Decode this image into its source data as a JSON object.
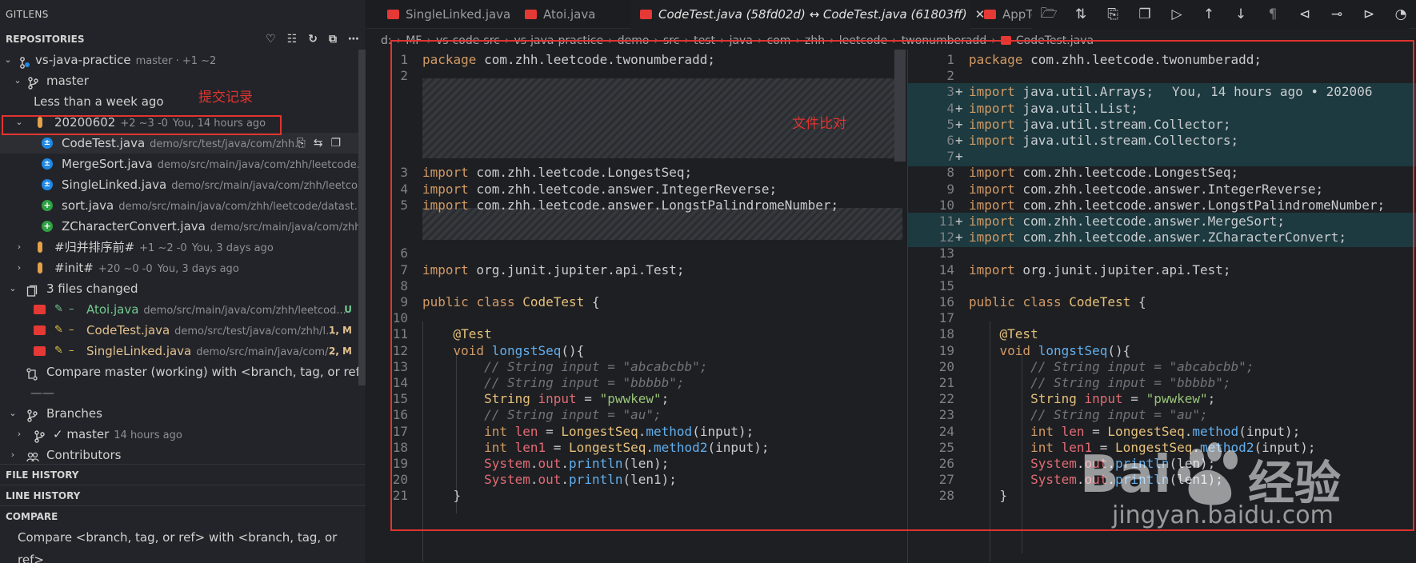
{
  "app": {
    "panel_title": "GITLENS"
  },
  "repositories": {
    "title": "REPOSITORIES",
    "repo": {
      "name": "vs-java-practice",
      "meta": "master · +1 ~2"
    },
    "branch": {
      "name": "master"
    },
    "period": "Less than a week ago",
    "commits": [
      {
        "hash": "20200602",
        "stats": "+2 ~3 -0",
        "when": "You, 14 hours ago",
        "files": [
          {
            "name": "CodeTest.java",
            "path": "demo/src/test/java/com/zhh..."
          },
          {
            "name": "MergeSort.java",
            "path": "demo/src/main/java/com/zhh/leetcode..."
          },
          {
            "name": "SingleLinked.java",
            "path": "demo/src/main/java/com/zhh/leetco..."
          },
          {
            "name": "sort.java",
            "path": "demo/src/main/java/com/zhh/leetcode/datast..."
          },
          {
            "name": "ZCharacterConvert.java",
            "path": "demo/src/main/java/com/zhh/..."
          }
        ]
      },
      {
        "hash": "#归并排序前#",
        "stats": "+1 ~2 -0",
        "when": "You, 3 days ago"
      },
      {
        "hash": "#init#",
        "stats": "+20 ~0 -0",
        "when": "You, 3 days ago"
      }
    ],
    "changed": {
      "label": "3 files changed",
      "files": [
        {
          "name": "Atoi.java",
          "path": "demo/src/main/java/com/zhh/leetcod...",
          "badge": "U",
          "color": "#73c991"
        },
        {
          "name": "CodeTest.java",
          "path": "demo/src/test/java/com/zhh/l...",
          "badge": "1, M",
          "color": "#e2c08d"
        },
        {
          "name": "SingleLinked.java",
          "path": "demo/src/main/java/com/...",
          "badge": "2, M",
          "color": "#e2c08d"
        }
      ],
      "pencil": "✎",
      "dash": "–"
    },
    "compare_working": "Compare master (working) with <branch, tag, or ref>",
    "divider": "——",
    "branches": {
      "label": "Branches",
      "item": "master",
      "item_when": "14 hours ago",
      "check": "✓"
    },
    "contributors": "Contributors"
  },
  "sections": {
    "file_history": "FILE HISTORY",
    "line_history": "LINE HISTORY",
    "compare": "COMPARE",
    "compare_item": "Compare <branch, tag, or ref> with <branch, tag, or ref>"
  },
  "tabs": [
    {
      "label": "SingleLinked.java"
    },
    {
      "label": "Atoi.java"
    },
    {
      "label": "CodeTest.java (58fd02d) ↔ CodeTest.java (61803ff)",
      "active": true
    },
    {
      "label": "AppTe"
    }
  ],
  "breadcrumb": [
    "d:",
    "MF",
    "vs-code-src",
    "vs-java-practice",
    "demo",
    "src",
    "test",
    "java",
    "com",
    "zhh",
    "leetcode",
    "twonumberadd",
    "CodeTest.java"
  ],
  "annotations": {
    "commit_records": "提交记录",
    "file_compare": "文件比对"
  },
  "left_editor": {
    "lines": [
      {
        "n": "1",
        "html": "<span class='kw'>package</span> com.zhh.leetcode.twonumberadd;"
      },
      {
        "n": "2",
        "html": ""
      },
      {
        "n": "3",
        "html": "<span class='kw'>import</span> com.zhh.leetcode.LongestSeq;"
      },
      {
        "n": "4",
        "html": "<span class='kw'>import</span> com.zhh.leetcode.answer.IntegerReverse;"
      },
      {
        "n": "5",
        "html": "<span class='kw'>import</span> com.zhh.leetcode.answer.LongstPalindromeNumber;"
      },
      {
        "n": "6",
        "html": ""
      },
      {
        "n": "7",
        "html": "<span class='kw'>import</span> org.junit.jupiter.api.Test;"
      },
      {
        "n": "8",
        "html": ""
      },
      {
        "n": "9",
        "html": "<span class='kw'>public</span> <span class='kw'>class</span> <span class='ty'>CodeTest</span> {"
      },
      {
        "n": "10",
        "html": ""
      },
      {
        "n": "11",
        "html": "    <span class='ann'>@Test</span>"
      },
      {
        "n": "12",
        "html": "    <span class='kw'>void</span> <span class='fn'>longstSeq</span>(){"
      },
      {
        "n": "13",
        "html": "        <span class='cm'>// String input = \"abcabcbb\";</span>"
      },
      {
        "n": "14",
        "html": "        <span class='cm'>// String input = \"bbbbb\";</span>"
      },
      {
        "n": "15",
        "html": "        <span class='ty'>String</span> <span class='var'>input</span> = <span class='str'>\"pwwkew\"</span>;"
      },
      {
        "n": "16",
        "html": "        <span class='cm'>// String input = \"au\";</span>"
      },
      {
        "n": "17",
        "html": "        <span class='kw'>int</span> <span class='var'>len</span> = <span class='ty'>LongestSeq</span>.<span class='fn'>method</span>(input);"
      },
      {
        "n": "18",
        "html": "        <span class='kw'>int</span> <span class='var'>len1</span> = <span class='ty'>LongestSeq</span>.<span class='fn'>method2</span>(input);"
      },
      {
        "n": "19",
        "html": "        <span class='var'>System</span>.<span class='var'>out</span>.<span class='fn'>println</span>(len);"
      },
      {
        "n": "20",
        "html": "        <span class='var'>System</span>.<span class='var'>out</span>.<span class='fn'>println</span>(len1);"
      },
      {
        "n": "21",
        "html": "    }"
      }
    ]
  },
  "right_editor": {
    "blame": "You, 14 hours ago • 202006",
    "lines": [
      {
        "n": "1",
        "html": "<span class='kw'>package</span> com.zhh.leetcode.twonumberadd;"
      },
      {
        "n": "2",
        "html": ""
      },
      {
        "n": "3",
        "add": true,
        "html": "<span class='kw'>import</span> java.util.Arrays;"
      },
      {
        "n": "4",
        "add": true,
        "html": "<span class='kw'>import</span> java.util.List;"
      },
      {
        "n": "5",
        "add": true,
        "html": "<span class='kw'>import</span> java.util.stream.Collector;"
      },
      {
        "n": "6",
        "add": true,
        "html": "<span class='kw'>import</span> java.util.stream.Collectors;"
      },
      {
        "n": "7",
        "add": true,
        "html": ""
      },
      {
        "n": "8",
        "html": "<span class='kw'>import</span> com.zhh.leetcode.LongestSeq;"
      },
      {
        "n": "9",
        "html": "<span class='kw'>import</span> com.zhh.leetcode.answer.IntegerReverse;"
      },
      {
        "n": "10",
        "html": "<span class='kw'>import</span> com.zhh.leetcode.answer.LongstPalindromeNumber;"
      },
      {
        "n": "11",
        "add": true,
        "html": "<span class='kw'>import</span> com.zhh.leetcode.answer.MergeSort;"
      },
      {
        "n": "12",
        "add": true,
        "html": "<span class='kw'>import</span> com.zhh.leetcode.answer.ZCharacterConvert;"
      },
      {
        "n": "13",
        "html": ""
      },
      {
        "n": "14",
        "html": "<span class='kw'>import</span> org.junit.jupiter.api.Test;"
      },
      {
        "n": "15",
        "html": ""
      },
      {
        "n": "16",
        "html": "<span class='kw'>public</span> <span class='kw'>class</span> <span class='ty'>CodeTest</span> {"
      },
      {
        "n": "17",
        "html": ""
      },
      {
        "n": "18",
        "html": "    <span class='ann'>@Test</span>"
      },
      {
        "n": "19",
        "html": "    <span class='kw'>void</span> <span class='fn'>longstSeq</span>(){"
      },
      {
        "n": "20",
        "html": "        <span class='cm'>// String input = \"abcabcbb\";</span>"
      },
      {
        "n": "21",
        "html": "        <span class='cm'>// String input = \"bbbbb\";</span>"
      },
      {
        "n": "22",
        "html": "        <span class='ty'>String</span> <span class='var'>input</span> = <span class='str'>\"pwwkew\"</span>;"
      },
      {
        "n": "23",
        "html": "        <span class='cm'>// String input = \"au\";</span>"
      },
      {
        "n": "24",
        "html": "        <span class='kw'>int</span> <span class='var'>len</span> = <span class='ty'>LongestSeq</span>.<span class='fn'>method</span>(input);"
      },
      {
        "n": "25",
        "html": "        <span class='kw'>int</span> <span class='var'>len1</span> = <span class='ty'>LongestSeq</span>.<span class='fn'>method2</span>(input);"
      },
      {
        "n": "26",
        "html": "        <span class='var'>System</span>.<span class='var'>out</span>.<span class='fn'>println</span>(len);"
      },
      {
        "n": "27",
        "html": "        <span class='var'>System</span>.<span class='var'>out</span>.<span class='fn'>println</span>(len1);"
      },
      {
        "n": "28",
        "html": "    }"
      }
    ]
  },
  "watermark": {
    "brand": "Bai",
    "brand2": "经验",
    "url": "jingyan.baidu.com"
  },
  "icons": {
    "toolbar": [
      "open-file-icon",
      "compare-changes-icon",
      "open-file-at-revision-icon",
      "copy-icon",
      "run-icon",
      "arrow-up-icon",
      "arrow-down-icon",
      "pilcrow-icon",
      "previous-change-icon",
      "commit-node-icon",
      "next-change-icon",
      "history-toggle-icon"
    ]
  }
}
